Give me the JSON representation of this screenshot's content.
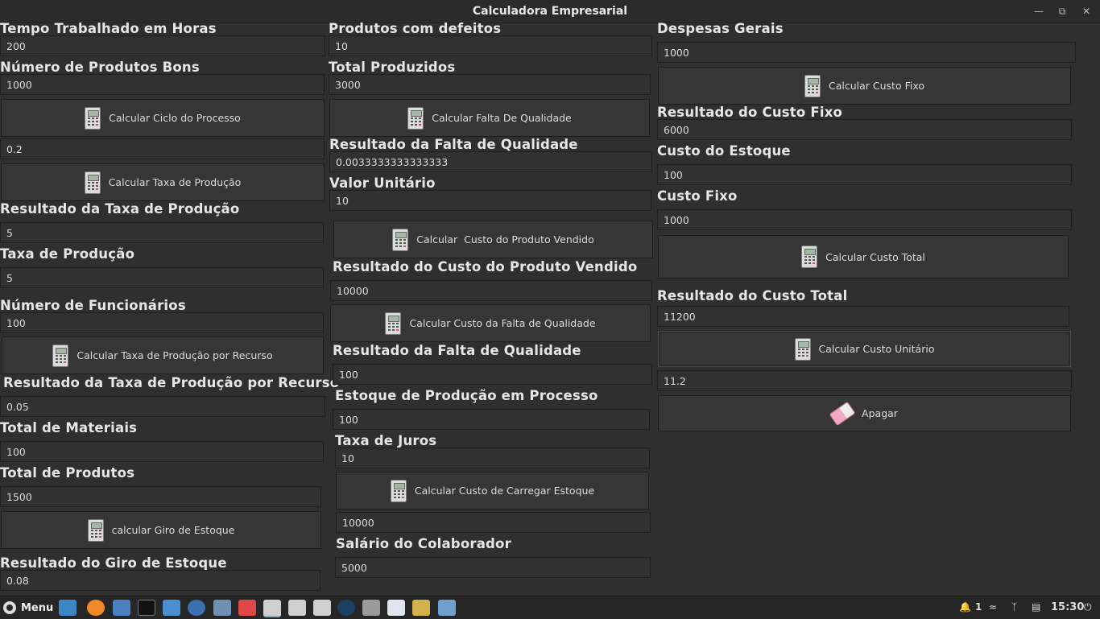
{
  "window": {
    "title": "Calculadora Empresarial"
  },
  "col1": {
    "tempo_label": "Tempo Trabalhado em Horas",
    "tempo_value": "200",
    "bons_label": "Número de Produtos Bons",
    "bons_value": "1000",
    "ciclo_button": "Calcular Ciclo do Processo",
    "ciclo_result": "0.2",
    "taxa_button": "Calcular Taxa de Produção",
    "res_taxa_label": "Resultado da Taxa de Produção",
    "res_taxa_value": "5",
    "taxa_label": "Taxa de Produção",
    "taxa_value": "5",
    "func_label": "Número de Funcionários",
    "func_value": "100",
    "taxa_recurso_button": "Calcular Taxa de Produção por Recurso",
    "res_recurso_label": "Resultado da Taxa de Produção por Recurso",
    "res_recurso_value": "0.05",
    "materiais_label": "Total de Materiais",
    "materiais_value": "100",
    "produtos_label": "Total de Produtos",
    "produtos_value": "1500",
    "giro_button": "calcular Giro de Estoque",
    "res_giro_label": "Resultado do Giro de Estoque",
    "res_giro_value": "0.08"
  },
  "col2": {
    "defeitos_label": "Produtos com defeitos",
    "defeitos_value": "10",
    "total_prod_label": "Total Produzidos",
    "total_prod_value": "3000",
    "falta_button": "Calcular Falta De Qualidade",
    "res_falta_label": "Resultado da Falta de Qualidade",
    "res_falta_value": "0.0033333333333333",
    "valor_label": "Valor Unitário",
    "valor_value": "10",
    "cpv_button": "Calcular  Custo do Produto Vendido",
    "res_cpv_label": "Resultado do Custo do Produto Vendido",
    "res_cpv_value": "10000",
    "custo_falta_button": "Calcular Custo da Falta de Qualidade",
    "res_falta2_label": "Resultado da Falta de Qualidade",
    "res_falta2_value": "100",
    "estoque_proc_label": "Estoque de Produção em Processo",
    "estoque_proc_value": "100",
    "juros_label": "Taxa de Juros",
    "juros_value": "10",
    "carregar_button": "Calcular Custo de Carregar Estoque",
    "carregar_result": "10000",
    "salario_label": "Salário do Colaborador",
    "salario_value": "5000"
  },
  "col3": {
    "despesas_label": "Despesas Gerais",
    "despesas_value": "1000",
    "custo_fixo_button": "Calcular Custo Fixo",
    "res_fixo_label": "Resultado do Custo Fixo",
    "res_fixo_value": "6000",
    "estoque_label": "Custo do Estoque",
    "estoque_value": "100",
    "fixo_label": "Custo Fixo",
    "fixo_value": "1000",
    "total_button": "Calcular Custo Total",
    "res_total_label": "Resultado do Custo Total",
    "res_total_value": "11200",
    "unitario_button": "Calcular Custo Unitário",
    "unitario_result": "11.2",
    "apagar_button": "Apagar"
  },
  "taskbar": {
    "menu_label": "Menu",
    "notif_count": "1",
    "clock": "15:30"
  }
}
